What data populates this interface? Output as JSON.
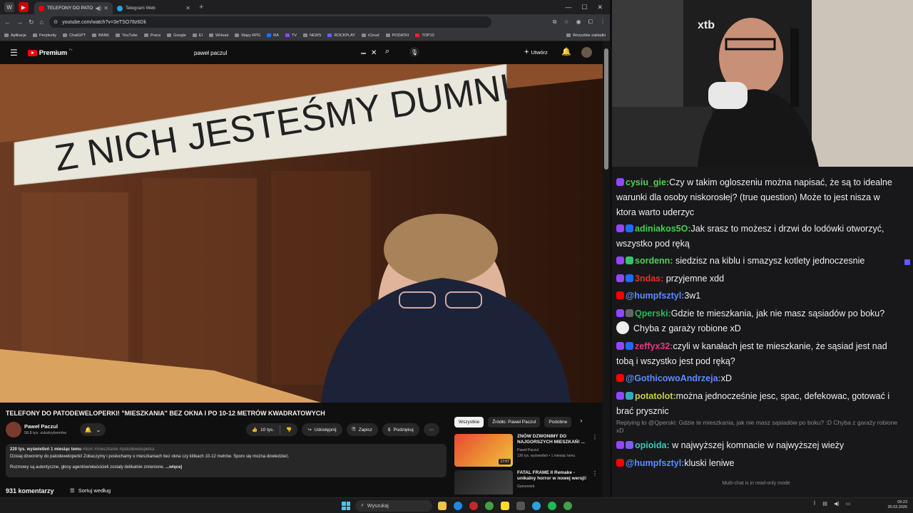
{
  "browser": {
    "tabs": [
      {
        "title": "TELEFONY DO PATODEWEL",
        "active": true
      },
      {
        "title": "Telegram Web",
        "active": false
      }
    ],
    "url": "youtube.com/watch?v=3eTSO78z6Dk",
    "bookmarks": [
      "Aplikacje",
      "Perplexity",
      "ChatGPT",
      "BANK",
      "YouTube",
      "Praca",
      "Google",
      "EI",
      "WHead",
      "Mapy RPG",
      "RA",
      "TV",
      "NEWS",
      "ROCKPLAY",
      "iCloud",
      "PODATKI",
      "TOP10"
    ],
    "bookmarks_all": "Wszystkie zakładki"
  },
  "youtube": {
    "logo": "Premium",
    "logo_region": "PL",
    "search_query": "paweł paczul",
    "create_label": "Utwórz",
    "video_caption_text": "Z NICH JESTEŚMY DUMNI",
    "title": "TELEFONY DO PATODEWELOPERKI! \"MIESZKANIA\" BEZ OKNA I PO 10-12 METRÓW KWADRATOWYCH",
    "channel": {
      "name": "Paweł Paczul",
      "subs": "58,8 tys. subskrybentów"
    },
    "actions": {
      "likes": "10 tys.",
      "share": "Udostępnij",
      "save": "Zapisz",
      "thanks": "Podziękuj"
    },
    "description": {
      "stats": "220 tys. wyświetleń  1 miesiąc temu",
      "tags": "#dom #mieszkanie #patodeweloperka",
      "line1": "Dzisiaj dzwonimy do patodeweloperki! Zobaczymy i posłuchamy o mieszkaniach bez okna czy klitkach 10-12 metrów. Sporo się można dowiedzieć.",
      "line2": "Rozmowy są autentyczne, głosy agentów/właścicieli zostały delikatnie zmienione.",
      "more": "...więcej"
    },
    "comments_count": "931 komentarzy",
    "sort_label": "Sortuj według",
    "chips": [
      "Wszystkie",
      "Źródło: Paweł Paczul",
      "Podobne"
    ],
    "recommended": [
      {
        "title": "ZNÓW DZWONIMY DO NAJGORSZYCH MIESZKAŃ! ...",
        "channel": "Paweł Paczul",
        "meta": "130 tys. wyświetleń • 1 miesiąc temu",
        "duration": "17:07"
      },
      {
        "title": "FATAL FRAME II Remake - unikalny horror w nowej wersji!",
        "channel": "Gamerweb",
        "meta": "",
        "duration": ""
      }
    ]
  },
  "chat": {
    "messages": [
      {
        "user": "cysiu_gie:",
        "color": "#4fd14f",
        "platform": "tw",
        "text": "Czy w takim ogloszeniu można napisać, że są to idealne warunki dla osoby niskorosłej? (true question) Może to jest nisza w ktora warto uderzyc"
      },
      {
        "user": "adiniakos5O:",
        "color": "#44d14a",
        "platform": "tw",
        "text": "Jak srasz to możesz i drzwi do lodówki otworzyć, wszystko pod ręką"
      },
      {
        "user": "sordenn:",
        "color": "#4fd14f",
        "platform": "tw",
        "text": "siedzisz na kiblu i smazysz kotlety jednoczesnie"
      },
      {
        "user": "3ndas:",
        "color": "#e0342a",
        "platform": "tw",
        "text": "przyjemne xdd"
      },
      {
        "user": "@humpfsztyl:",
        "color": "#5b8cff",
        "platform": "yt",
        "text": "3w1"
      },
      {
        "user": "Qperski:",
        "color": "#2fb25a",
        "platform": "tw",
        "text": "Gdzie te mieszkania, jak nie masz sąsiadów po boku?"
      },
      {
        "user": "",
        "color": "#ffffff",
        "platform": "emote",
        "text": "Chyba z garaży robione xD"
      },
      {
        "user": "zeffyx32:",
        "color": "#e23b7e",
        "platform": "tw",
        "text": "czyli w kanałach jest te mieszkanie, że sąsiad jest nad tobą i wszystko jest pod ręką?"
      },
      {
        "user": "@GothicowoAndrzeja:",
        "color": "#5b8cff",
        "platform": "yt",
        "text": "xD"
      },
      {
        "user": "potatolot:",
        "color": "#c7d03a",
        "platform": "tw",
        "text": "można jednocześnie jesc, spac, defekowac, gotować i brać prysznic"
      },
      {
        "user": "opioida:",
        "color": "#3ec6b8",
        "platform": "tw",
        "text": "w najwyższej komnacie w najwyższej wieży"
      },
      {
        "user": "@humpfsztyl:",
        "color": "#5b8cff",
        "platform": "yt",
        "text": "kluski leniwe"
      }
    ],
    "reply_note": "Replying to @Qperski: Gdzie te mieszkania, jak nie masz sąsiadów po boku? :D Chyba z garaży robione xD",
    "readonly": "Multi-chat is in read-only mode"
  },
  "camera": {
    "logo": "xtb"
  },
  "taskbar": {
    "search": "Wyszukaj",
    "time": "09:23",
    "date": "30.03.2026"
  }
}
